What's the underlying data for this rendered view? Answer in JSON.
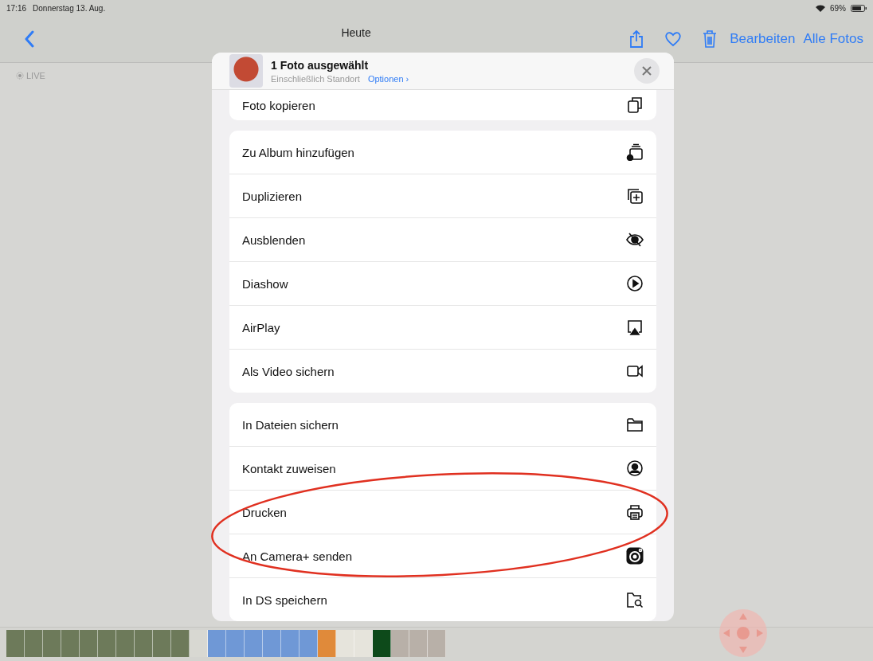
{
  "status_bar": {
    "time": "17:16",
    "date": "Donnerstag 13. Aug.",
    "battery": "69%"
  },
  "nav": {
    "title": "Heute",
    "actions": [
      "Bearbeiten",
      "Alle Fotos"
    ]
  },
  "live_label": "LIVE",
  "sheet": {
    "title": "1 Foto ausgewählt",
    "subtitle": "Einschließlich Standort",
    "options_link": "Optionen",
    "options_chevron": "›",
    "groups": [
      {
        "rows": [
          "Foto kopieren"
        ]
      },
      {
        "rows": [
          "Zu Album hinzufügen",
          "Duplizieren",
          "Ausblenden",
          "Diashow",
          "AirPlay",
          "Als Video sichern"
        ]
      },
      {
        "rows": [
          "In Dateien sichern",
          "Kontakt zuweisen",
          "Drucken",
          "An Camera+ senden",
          "In DS speichern"
        ]
      }
    ]
  }
}
